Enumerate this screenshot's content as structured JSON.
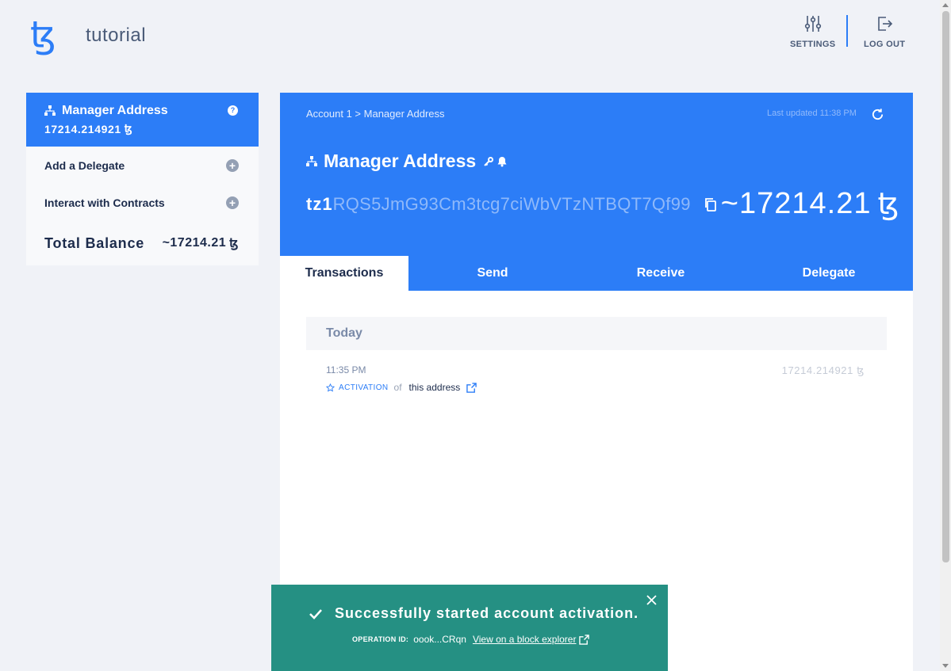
{
  "app": {
    "name": "tutorial",
    "logo_icon": "tezos-logo-icon",
    "accent": "#2c7df7"
  },
  "topbar": {
    "settings_label": "SETTINGS",
    "logout_label": "LOG OUT"
  },
  "sidebar": {
    "account": {
      "title": "Manager Address",
      "balance": "17214.214921",
      "currency": "ꜩ",
      "help": "?"
    },
    "items": [
      {
        "label": "Add a Delegate"
      },
      {
        "label": "Interact with Contracts"
      }
    ],
    "total_label": "Total Balance",
    "total_value": "~17214.21",
    "total_currency": "ꜩ"
  },
  "main": {
    "breadcrumb": "Account 1 > Manager Address",
    "last_updated": "Last updated 11:38 PM",
    "title": "Manager Address",
    "address_prefix": "tz1",
    "address_rest": "RQS5JmG93Cm3tcg7ciWbVTzNTBQT7Qf99",
    "balance": "~17214.21",
    "currency": "ꜩ",
    "tabs": [
      {
        "label": "Transactions"
      },
      {
        "label": "Send"
      },
      {
        "label": "Receive"
      },
      {
        "label": "Delegate"
      }
    ],
    "transactions": {
      "day": "Today",
      "items": [
        {
          "time": "11:35 PM",
          "amount": "17214.214921 ꜩ",
          "type": "ACTIVATION",
          "of": "of",
          "target": "this address"
        }
      ]
    }
  },
  "toast": {
    "message": "Successfully started account activation.",
    "operation_label": "OPERATION ID:",
    "operation_id": "oook...CRqn",
    "link_label": "View on a block explorer",
    "color": "#259083"
  }
}
